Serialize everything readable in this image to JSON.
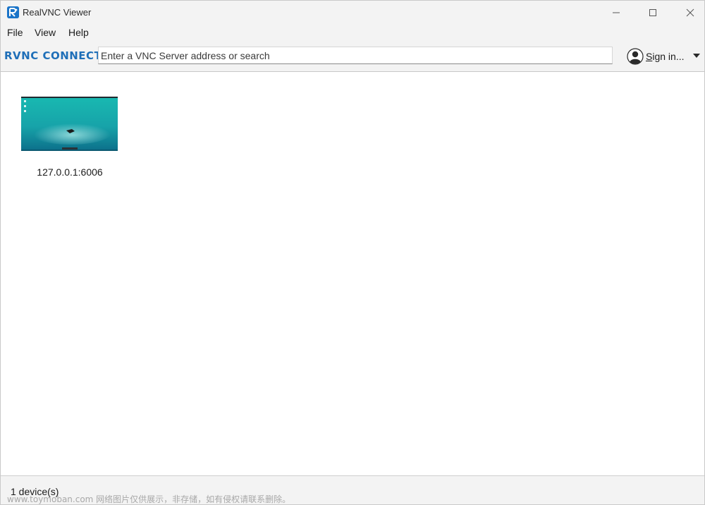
{
  "window": {
    "title": "RealVNC Viewer"
  },
  "menu": {
    "items": [
      {
        "label": "File"
      },
      {
        "label": "View"
      },
      {
        "label": "Help"
      }
    ]
  },
  "toolbar": {
    "brand": "RVNC CONNECT",
    "search_placeholder": "Enter a VNC Server address or search",
    "search_value": "",
    "signin_label": "Sign in..."
  },
  "devices": [
    {
      "label": "127.0.0.1:6006"
    }
  ],
  "status": {
    "text": "1 device(s)"
  },
  "watermark": "www.toymoban.com 网络图片仅供展示，非存储，如有侵权请联系删除。",
  "icons": {
    "app": "realvnc-app-icon",
    "minimize": "minimize-icon",
    "maximize": "maximize-icon",
    "close": "close-icon",
    "user": "user-avatar-icon",
    "dropdown": "chevron-down-icon"
  },
  "colors": {
    "accent": "#1f6fb8",
    "chrome": "#f3f3f3",
    "thumb_teal": "#1aa7a6"
  }
}
